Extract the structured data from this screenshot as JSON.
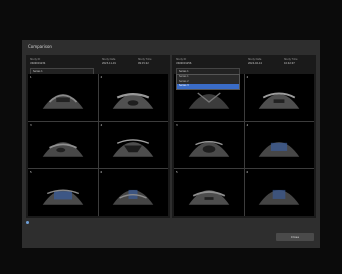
{
  "window": {
    "title": "Comparison"
  },
  "left_pane": {
    "headers": [
      "Study ID",
      "Study Date",
      "Study Time"
    ],
    "values": [
      "US00001234",
      "2023-11-01",
      "09:15:22"
    ],
    "selected_series": "Series 1",
    "images": [
      "1",
      "2",
      "3",
      "4",
      "5",
      "6"
    ]
  },
  "right_pane": {
    "headers": [
      "Study ID",
      "Study Date",
      "Study Time"
    ],
    "values": [
      "US00001256",
      "2024-02-14",
      "10:42:07"
    ],
    "dropdown_options": [
      "Series 1",
      "Series 2",
      "Series 3"
    ],
    "selected_index": 2,
    "images": [
      "1",
      "2",
      "3",
      "4",
      "5",
      "6"
    ]
  },
  "footer": {
    "close_label": "Close"
  }
}
